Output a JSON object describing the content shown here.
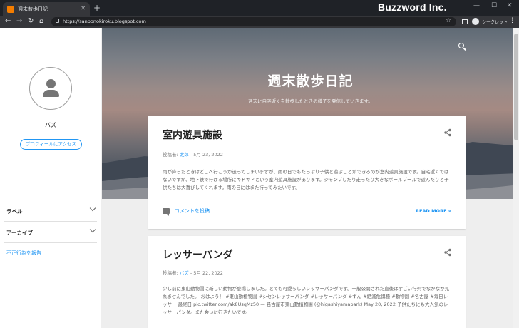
{
  "browser": {
    "tab_title": "週末散歩日記",
    "tab_close": "✕",
    "new_tab": "+",
    "url": "https://sanponokiroku.blogspot.com",
    "profile_label": "シークレット",
    "brand": "Buzzword Inc.",
    "window_controls": [
      "—",
      "☐",
      "✕"
    ]
  },
  "sidebar": {
    "profile_name": "バズ",
    "profile_button": "プロフィールにアクセス",
    "sections": [
      {
        "label": "ラベル"
      },
      {
        "label": "アーカイブ"
      }
    ],
    "report_link": "不正行為を報告"
  },
  "header": {
    "title": "週末散歩日記",
    "description": "週末に自宅近くを散歩したときの様子を発信していきます。"
  },
  "posts": [
    {
      "title": "室内遊具施設",
      "meta_prefix": "投稿者:",
      "author": "太郎",
      "date": "- 5月 23, 2022",
      "snippet": "雨が降ったときはどこへ行こうか迷ってしまいますが、雨の日でもたっぷり子供と遊ぶことができるのが室内遊具施設です。自宅近くではないですが、地下鉄で行ける場所にキドキドという室内遊具施設があります。ジャンプしたり走ったり大きなボールプールで遊んだりと子供たちは大喜びしてくれます。雨の日にはまた行ってみたいです。",
      "comment_link": "コメントを投稿",
      "read_more": "READ MORE »"
    },
    {
      "title": "レッサーパンダ",
      "meta_prefix": "投稿者:",
      "author": "バズ",
      "date": "- 5月 22, 2022",
      "snippet": "少し前に東山動物園に新しい動物が登場しました。とても可愛らしいレッサーパンダです。一般公開された直後はすごい行列でなかなか見れませんでした。 おはよう！ #東山動植物園 #シセンレッサーパンダ #レッサーパンダ #ずん #絶滅危惧種 #動物園 #名古屋 #毎日レッサー 最終日 pic.twitter.com/ak8UsqMz50 — 名古屋市東山動植物園 (@higashiyamapark) May 20, 2022 子供たちにも大人気のレッサーパンダ。また会いに行きたいです。"
    }
  ],
  "colors": {
    "link": "#2196f3",
    "title_bar": "#1f2227",
    "toolbar": "#35363a"
  },
  "icons": [
    "blogger-favicon",
    "back-icon",
    "forward-icon",
    "reload-icon",
    "home-icon",
    "lock-icon",
    "star-icon",
    "search-icon",
    "share-icon",
    "comment-icon",
    "chevron-down-icon",
    "avatar-icon"
  ]
}
